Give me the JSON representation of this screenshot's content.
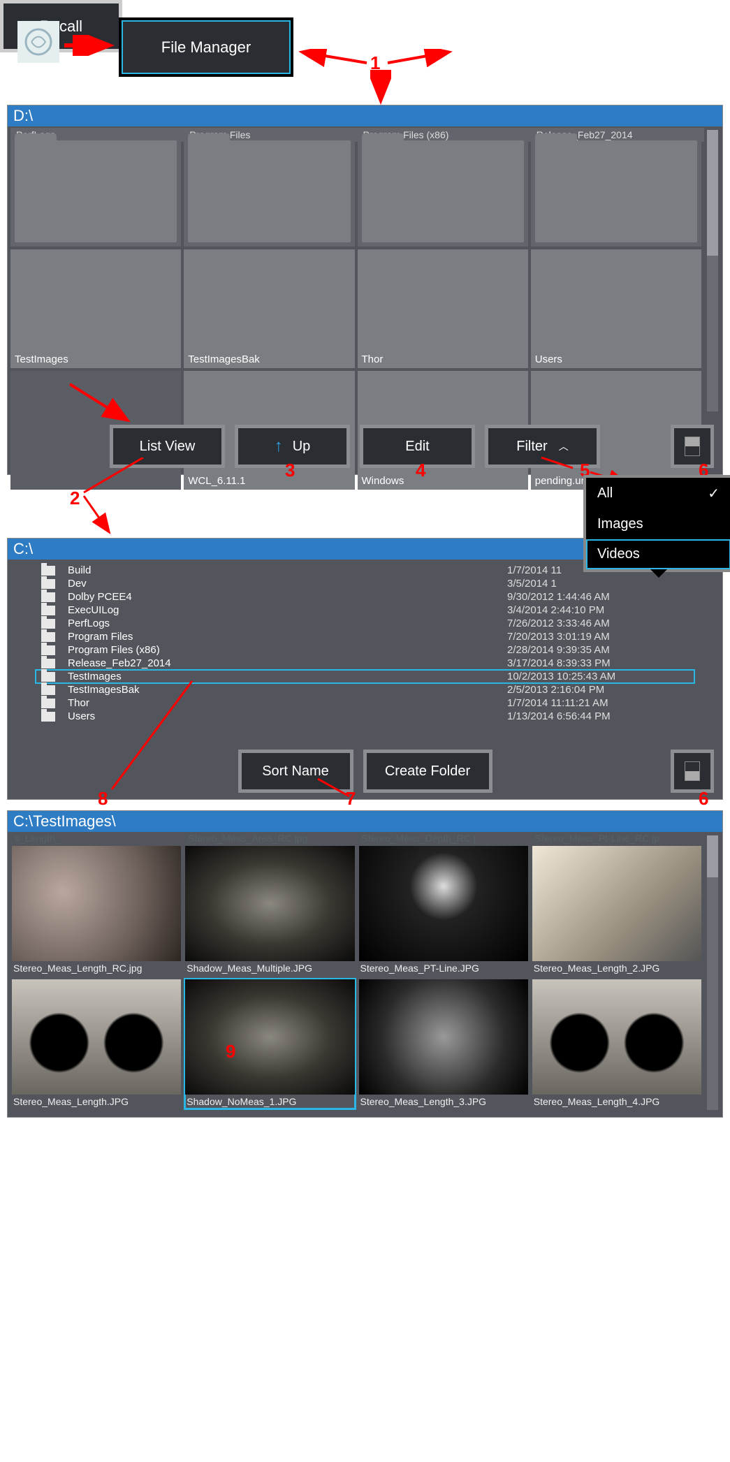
{
  "top": {
    "file_manager": "File Manager",
    "recall": "Recall",
    "thumbnail_view": "Thumbnail View"
  },
  "callouts": {
    "n1": "1",
    "n2": "2",
    "n3": "3",
    "n4": "4",
    "n5": "5",
    "n6": "6",
    "n7": "7",
    "n8": "8",
    "n9": "9"
  },
  "panel1": {
    "path": "D:\\",
    "row1": [
      "PerfLogs",
      "Program Files",
      "Program Files (x86)",
      "Release_Feb27_2014"
    ],
    "row2": [
      "TestImages",
      "TestImagesBak",
      "Thor",
      "Users"
    ],
    "row3": [
      "",
      "WCL_6.11.1",
      "Windows",
      "pending.un"
    ],
    "toolbar": {
      "list_view": "List View",
      "up": "Up",
      "edit": "Edit",
      "filter": "Filter"
    }
  },
  "filter_menu": {
    "all": "All",
    "images": "Images",
    "videos": "Videos"
  },
  "panel2": {
    "path": "C:\\",
    "rows": [
      {
        "name": "Build",
        "date": "1/7/2014 11"
      },
      {
        "name": "Dev",
        "date": "3/5/2014 1"
      },
      {
        "name": "Dolby PCEE4",
        "date": "9/30/2012 1:44:46 AM"
      },
      {
        "name": "ExecUILog",
        "date": "3/4/2014 2:44:10 PM"
      },
      {
        "name": "PerfLogs",
        "date": "7/26/2012 3:33:46 AM"
      },
      {
        "name": "Program Files",
        "date": "7/20/2013 3:01:19 AM"
      },
      {
        "name": "Program Files (x86)",
        "date": "2/28/2014 9:39:35 AM"
      },
      {
        "name": "Release_Feb27_2014",
        "date": "3/17/2014 8:39:33 PM"
      },
      {
        "name": "TestImages",
        "date": "10/2/2013 10:25:43 AM",
        "selected": true
      },
      {
        "name": "TestImagesBak",
        "date": "2/5/2013 2:16:04 PM"
      },
      {
        "name": "Thor",
        "date": "1/7/2014 11:11:21 AM"
      },
      {
        "name": "Users",
        "date": "1/13/2014 6:56:44 PM"
      }
    ],
    "toolbar": {
      "sort": "Sort Name",
      "create": "Create Folder"
    }
  },
  "panel3": {
    "path": "C:\\TestImages\\",
    "dim_row": [
      "s_Length_",
      "Stereo_Meas_Area_RC.jpg",
      "Stereo_Meas_Depth_RC.j",
      "Stereo_Meas_Pt-Line_RC.jp"
    ],
    "tiles": [
      {
        "name": "Stereo_Meas_Length_RC.jpg",
        "cls": "th1"
      },
      {
        "name": "Shadow_Meas_Multiple.JPG",
        "cls": "th2"
      },
      {
        "name": "Stereo_Meas_PT-Line.JPG",
        "cls": "th3"
      },
      {
        "name": "Stereo_Meas_Length_2.JPG",
        "cls": "th4"
      },
      {
        "name": "Stereo_Meas_Length.JPG",
        "cls": "th7"
      },
      {
        "name": "Shadow_NoMeas_1.JPG",
        "cls": "th2",
        "selected": true
      },
      {
        "name": "Stereo_Meas_Length_3.JPG",
        "cls": "th6"
      },
      {
        "name": "Stereo_Meas_Length_4.JPG",
        "cls": "th7"
      }
    ]
  }
}
